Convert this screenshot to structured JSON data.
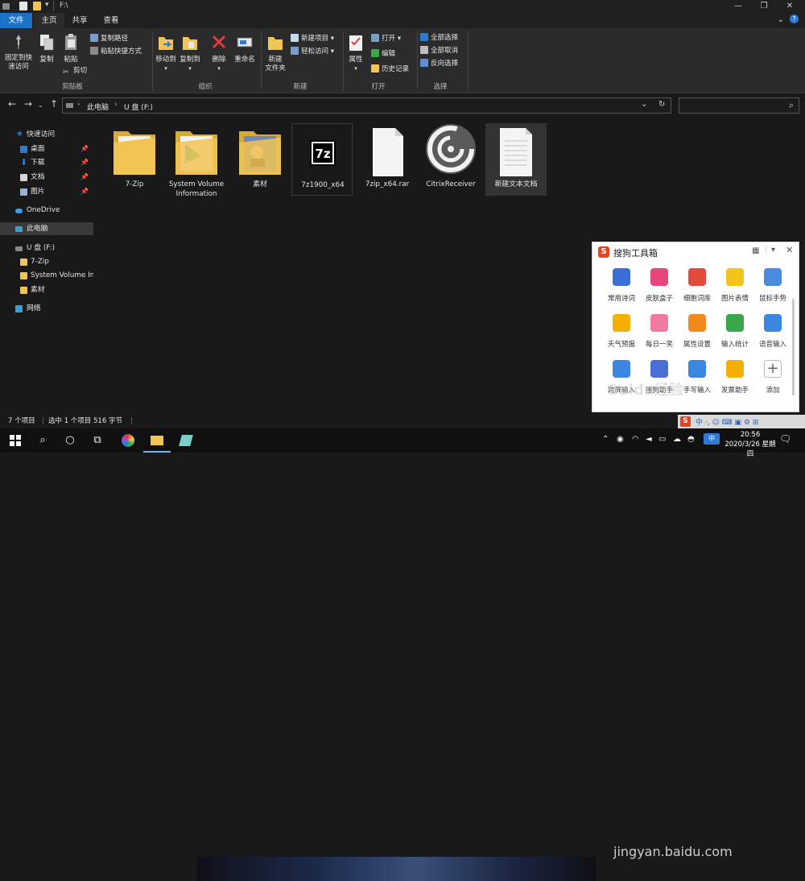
{
  "window": {
    "path": "F:\\",
    "controls": {
      "minimize": "—",
      "maximize": "❐",
      "close": "✕"
    }
  },
  "ribbon": {
    "tabs": [
      "文件",
      "主页",
      "共享",
      "查看"
    ],
    "clipboard": {
      "pin_label_1": "固定到快",
      "pin_label_2": "速访问",
      "copy": "复制",
      "paste": "粘贴",
      "copy_path": "复制路径",
      "paste_shortcut": "粘贴快捷方式",
      "cut": "剪切",
      "group": "剪贴板"
    },
    "organize": {
      "move_to": "移动到",
      "copy_to": "复制到",
      "delete": "删除",
      "rename": "重命名",
      "group": "组织"
    },
    "new": {
      "new_folder_1": "新建",
      "new_folder_2": "文件夹",
      "new_item": "新建项目",
      "easy_access": "轻松访问",
      "group": "新建"
    },
    "open": {
      "properties": "属性",
      "open": "打开",
      "edit": "编辑",
      "history": "历史记录",
      "group": "打开"
    },
    "select": {
      "select_all": "全部选择",
      "select_none": "全部取消",
      "invert": "反向选择",
      "group": "选择"
    }
  },
  "address": {
    "crumbs": [
      "此电脑",
      "U 盘 (F:)"
    ],
    "search_placeholder": ""
  },
  "nav": {
    "quick_access": "快速访问",
    "desktop": "桌面",
    "downloads": "下载",
    "documents": "文档",
    "pictures": "图片",
    "onedrive": "OneDrive",
    "this_pc": "此电脑",
    "usb": "U 盘 (F:)",
    "sub_7zip": "7-Zip",
    "sub_svi": "System Volume In",
    "sub_sucai": "素材",
    "network": "网络"
  },
  "files": [
    {
      "name": "7-Zip",
      "type": "folder"
    },
    {
      "name": "System Volume Information",
      "type": "folder"
    },
    {
      "name": "素材",
      "type": "folder"
    },
    {
      "name": "7z1900_x64",
      "type": "exe-7z"
    },
    {
      "name": "7zip_x64.rar",
      "type": "blank"
    },
    {
      "name": "CitrixReceiver",
      "type": "citrix"
    },
    {
      "name": "新建文本文档",
      "type": "text",
      "selected": true
    }
  ],
  "status": {
    "items": "7 个项目",
    "selected": "选中 1 个项目  516 字节"
  },
  "sogou": {
    "title": "搜狗工具箱",
    "tools": [
      "常用诗词",
      "皮肤盒子",
      "细胞词库",
      "图片表情",
      "鼠标手势",
      "天气预报",
      "每日一笑",
      "属性设置",
      "输入统计",
      "语音输入",
      "跨屏输入",
      "搜狗助手",
      "手写输入",
      "发票助手",
      "添加"
    ],
    "tool_colors": [
      "#3a6fd8",
      "#e8457a",
      "#e24a3b",
      "#f5c21b",
      "#4a8be0",
      "#f4b000",
      "#f07aa0",
      "#f08a1c",
      "#3aa84a",
      "#3a86e0",
      "#3a86e0",
      "#4a6ed8",
      "#3a86e0",
      "#f4b000",
      "#ffffff"
    ]
  },
  "taskbar": {
    "time": "20:56",
    "date": "2020/3/26 星期四"
  },
  "watermark": {
    "text": "Baidu经验",
    "url": "jingyan.baidu.com"
  }
}
